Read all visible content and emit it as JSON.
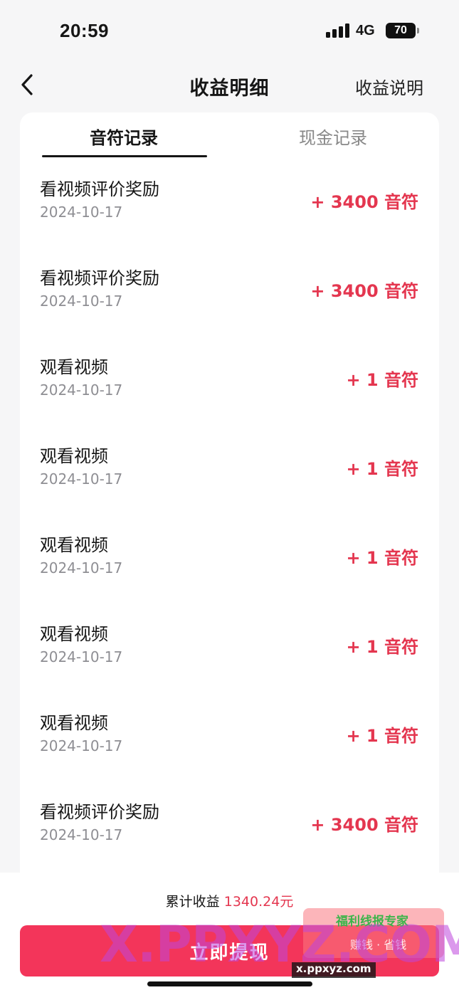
{
  "status_bar": {
    "time": "20:59",
    "network": "4G",
    "battery": "70"
  },
  "nav": {
    "title": "收益明细",
    "action": "收益说明",
    "back_icon": "chevron-left-icon"
  },
  "tabs": [
    {
      "label": "音符记录",
      "active": true
    },
    {
      "label": "现金记录",
      "active": false
    }
  ],
  "records": [
    {
      "title": "看视频评价奖励",
      "date": "2024-10-17",
      "amount": "+ 3400 音符"
    },
    {
      "title": "看视频评价奖励",
      "date": "2024-10-17",
      "amount": "+ 3400 音符"
    },
    {
      "title": "观看视频",
      "date": "2024-10-17",
      "amount": "+ 1 音符"
    },
    {
      "title": "观看视频",
      "date": "2024-10-17",
      "amount": "+ 1 音符"
    },
    {
      "title": "观看视频",
      "date": "2024-10-17",
      "amount": "+ 1 音符"
    },
    {
      "title": "观看视频",
      "date": "2024-10-17",
      "amount": "+ 1 音符"
    },
    {
      "title": "观看视频",
      "date": "2024-10-17",
      "amount": "+ 1 音符"
    },
    {
      "title": "看视频评价奖励",
      "date": "2024-10-17",
      "amount": "+ 3400 音符"
    }
  ],
  "footer": {
    "total_label": "累计收益",
    "total_value": "1340.24元",
    "button_label": "立即提现"
  },
  "watermark": {
    "text": "X.PPXYZ.COM",
    "badge_title": "福利线报专家",
    "badge_sub": "赚钱 · 省钱",
    "url": "x.ppxyz.com"
  },
  "colors": {
    "accent": "#e4364f",
    "button": "#f3355a",
    "background": "#f6f6f7"
  }
}
